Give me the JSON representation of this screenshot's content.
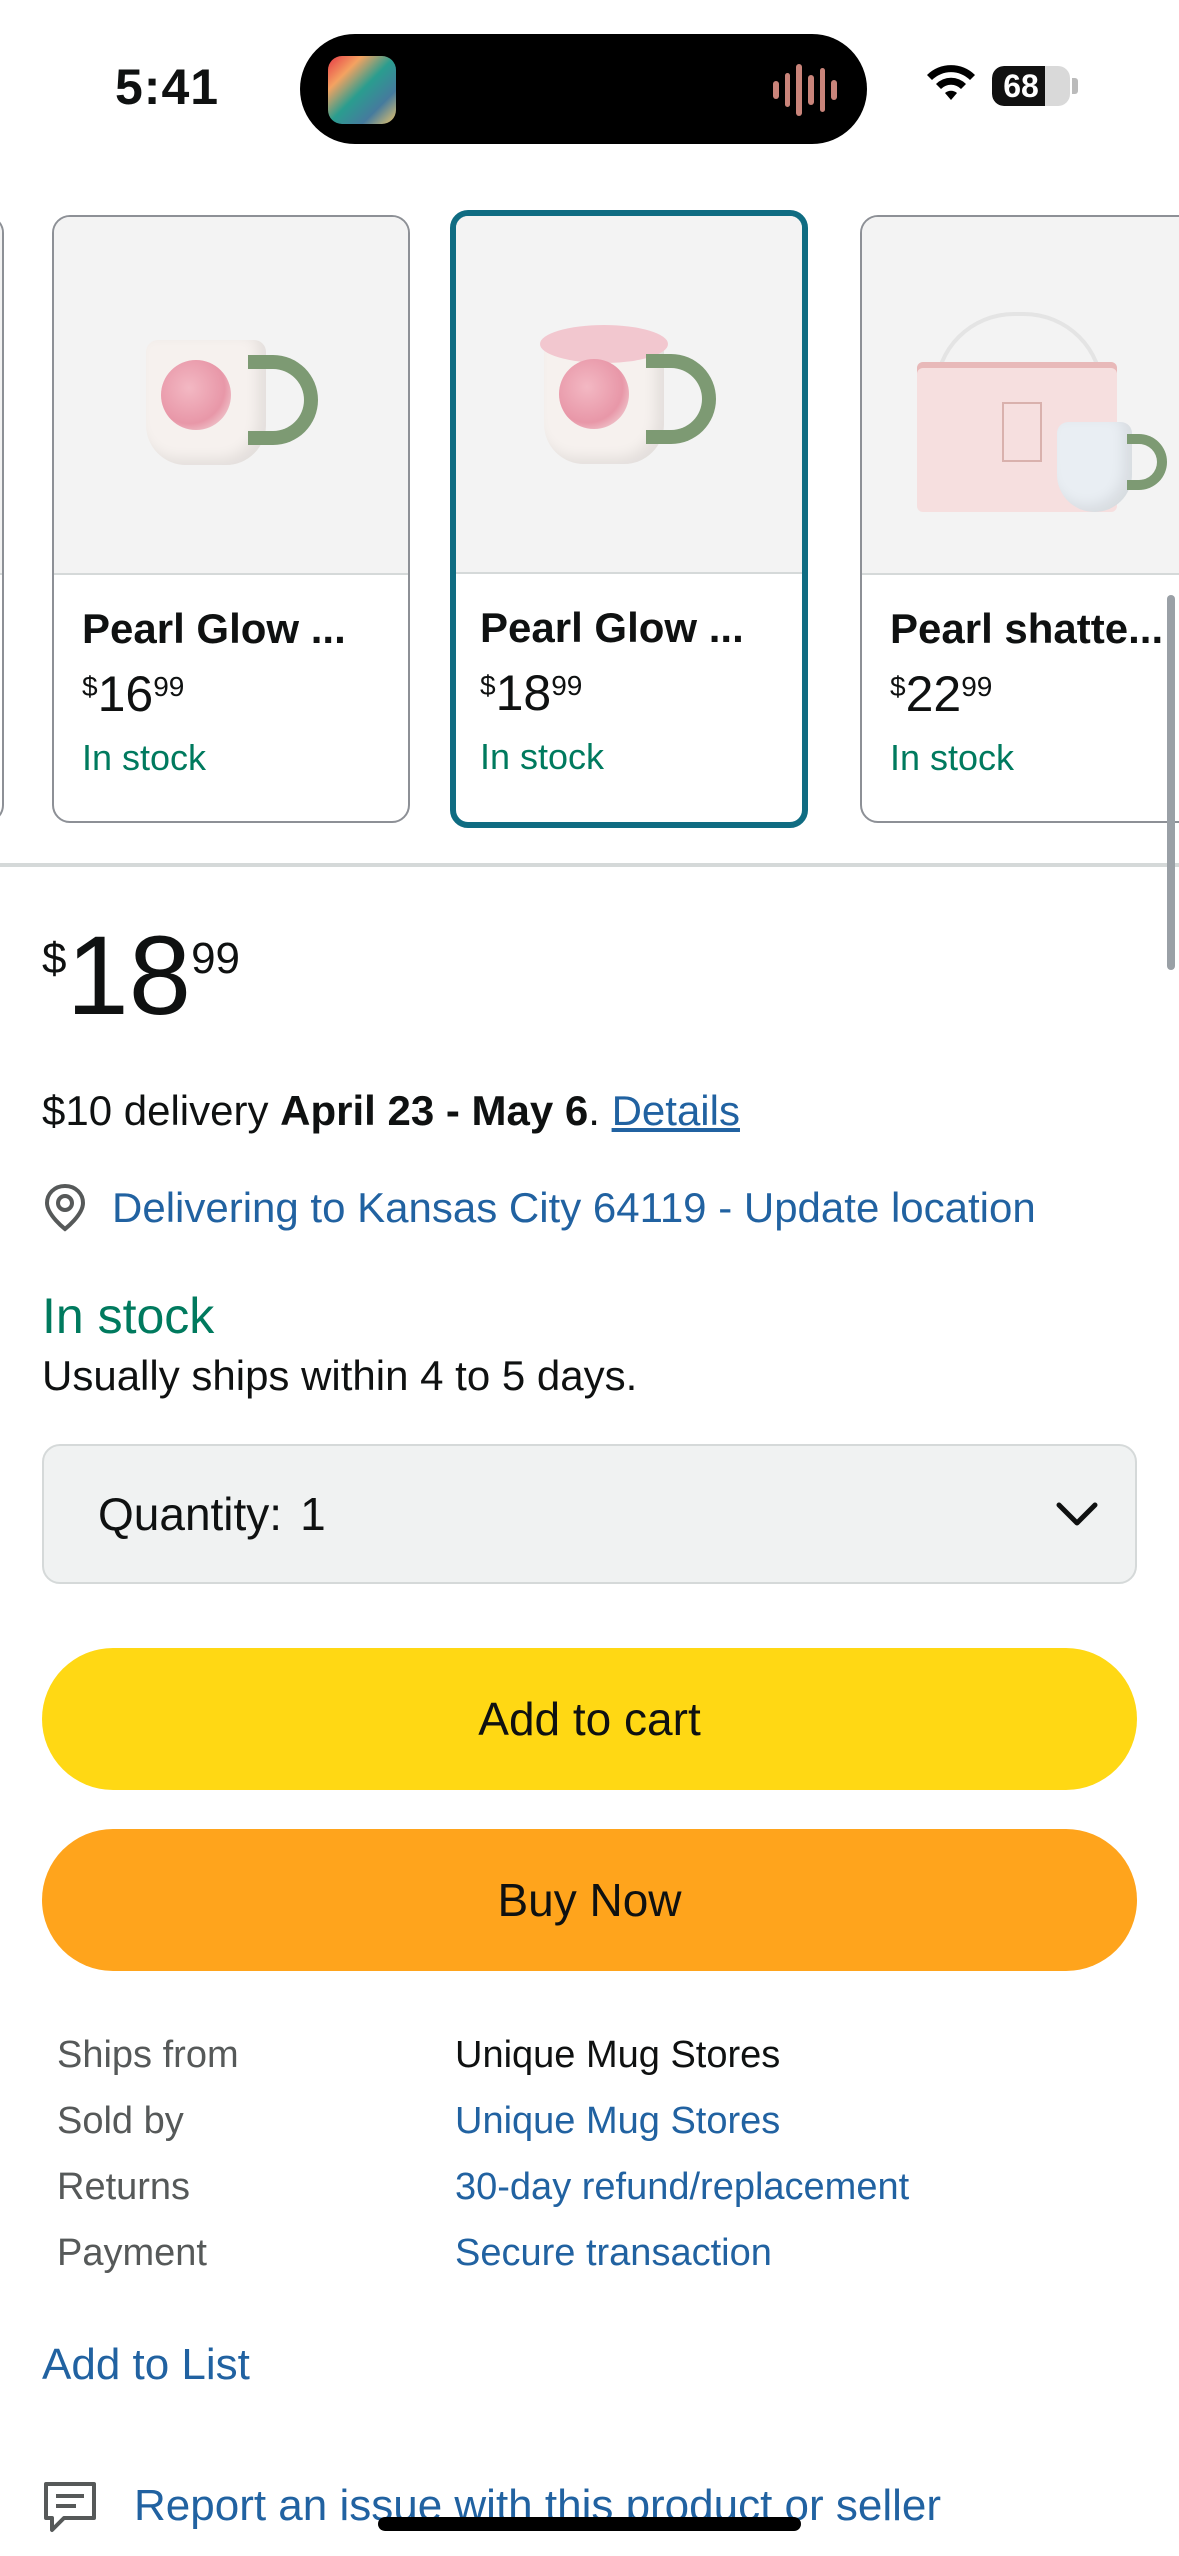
{
  "status_bar": {
    "time": "5:41",
    "battery_percent": "68",
    "battery_level": 0.68
  },
  "variants": [
    {
      "title": "Pearl Glow ...",
      "price_symbol": "$",
      "price_whole": "16",
      "price_cents": "99",
      "stock": "In stock",
      "selected": false
    },
    {
      "title": "Pearl Glow ...",
      "price_symbol": "$",
      "price_whole": "18",
      "price_cents": "99",
      "stock": "In stock",
      "selected": true
    },
    {
      "title": "Pearl shatte...",
      "price_symbol": "$",
      "price_whole": "22",
      "price_cents": "99",
      "stock": "In stock",
      "selected": false
    }
  ],
  "price": {
    "symbol": "$",
    "whole": "18",
    "cents": "99"
  },
  "delivery": {
    "prefix": "$10 delivery ",
    "dates": "April 23 - May 6",
    "suffix": ". ",
    "details_link": "Details"
  },
  "location": {
    "text": "Delivering to Kansas City 64119 - Update location"
  },
  "availability": {
    "status": "In stock",
    "note": "Usually ships within 4 to 5 days."
  },
  "quantity": {
    "label": "Quantity:",
    "value": "1"
  },
  "buttons": {
    "add_to_cart": "Add to cart",
    "buy_now": "Buy Now"
  },
  "info": [
    {
      "key": "Ships from",
      "value": "Unique Mug Stores",
      "is_link": false
    },
    {
      "key": "Sold by",
      "value": "Unique Mug Stores",
      "is_link": true
    },
    {
      "key": "Returns",
      "value": "30-day refund/replacement",
      "is_link": true
    },
    {
      "key": "Payment",
      "value": "Secure transaction",
      "is_link": true
    }
  ],
  "add_to_list": "Add to List",
  "report": "Report an issue with this product or seller",
  "colors": {
    "link": "#2162a1",
    "in_stock": "#007a5e",
    "add_to_cart_bg": "#ffd814",
    "buy_now_bg": "#ffa41c",
    "selected_border": "#0f6c82"
  }
}
